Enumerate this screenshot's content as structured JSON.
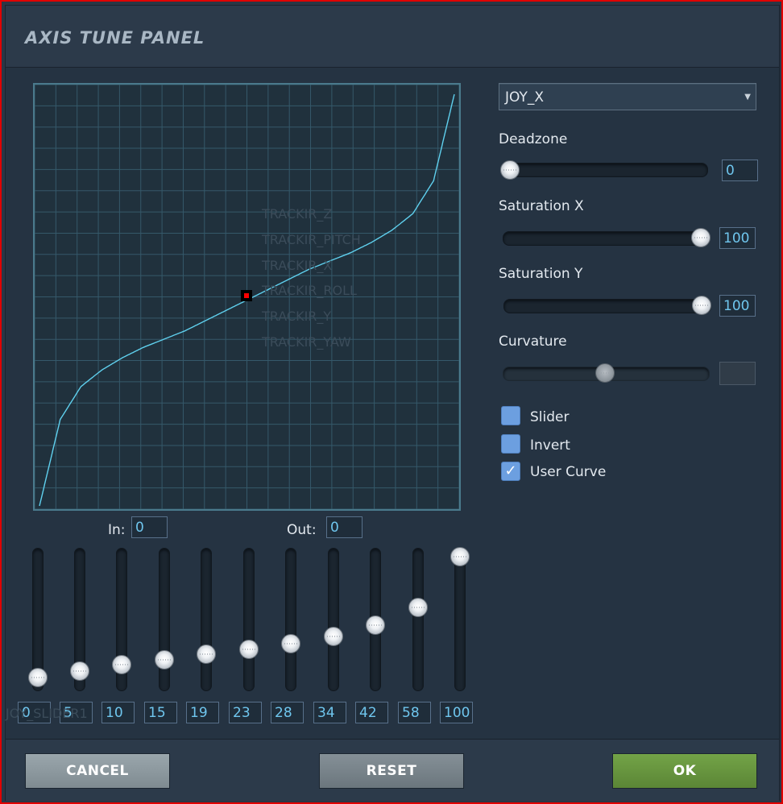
{
  "window": {
    "title": "AXIS TUNE PANEL"
  },
  "graph": {
    "ghost_items": [
      "TRACKIR_Z",
      "TRACKIR_PITCH",
      "TRACKIR_X",
      "TRACKIR_ROLL",
      "TRACKIR_Y",
      "TRACKIR_YAW"
    ],
    "curve_color": "#5fd0ee",
    "grid_color": "#35596a",
    "marker_color": "#ff0000"
  },
  "axis_select": {
    "value": "JOY_X"
  },
  "deadzone": {
    "label": "Deadzone",
    "value": "0",
    "level": 0
  },
  "saturation_x": {
    "label": "Saturation X",
    "value": "100",
    "level": 1
  },
  "saturation_y": {
    "label": "Saturation Y",
    "value": "100",
    "level": 1
  },
  "curvature": {
    "label": "Curvature",
    "value": "",
    "level": 0.5,
    "disabled": true
  },
  "options": {
    "slider": {
      "label": "Slider",
      "checked": false
    },
    "invert": {
      "label": "Invert",
      "checked": false
    },
    "user_curve": {
      "label": "User Curve",
      "checked": true
    }
  },
  "io": {
    "in_label": "In:",
    "in_value": "0",
    "out_label": "Out:",
    "out_value": "0"
  },
  "curve_points": [
    "0",
    "5",
    "10",
    "15",
    "19",
    "23",
    "28",
    "34",
    "42",
    "58",
    "100"
  ],
  "ghost_footer": "JOY_SLIDER1",
  "buttons": {
    "cancel": "CANCEL",
    "reset": "RESET",
    "ok": "OK"
  },
  "colors": {
    "accent_value": "#6fc6ee",
    "ok_button": "#6a9a40",
    "frame_border": "#e10000"
  }
}
